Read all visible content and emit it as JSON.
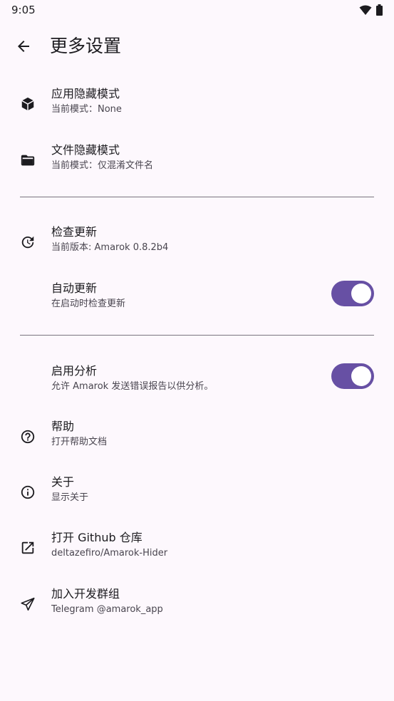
{
  "status": {
    "time": "9:05"
  },
  "header": {
    "title": "更多设置"
  },
  "sections": {
    "hide": {
      "app_hide": {
        "title": "应用隐藏模式",
        "subtitle": "当前模式：None"
      },
      "file_hide": {
        "title": "文件隐藏模式",
        "subtitle": "当前模式：仅混淆文件名"
      }
    },
    "update": {
      "check": {
        "title": "检查更新",
        "subtitle": "当前版本: Amarok 0.8.2b4"
      },
      "auto": {
        "title": "自动更新",
        "subtitle": "在启动时检查更新",
        "enabled": true
      }
    },
    "other": {
      "analytics": {
        "title": "启用分析",
        "subtitle": "允许 Amarok 发送错误报告以供分析。",
        "enabled": true
      },
      "help": {
        "title": "帮助",
        "subtitle": "打开帮助文档"
      },
      "about": {
        "title": "关于",
        "subtitle": "显示关于"
      },
      "github": {
        "title": "打开 Github 仓库",
        "subtitle": "deltazefiro/Amarok-Hider"
      },
      "group": {
        "title": "加入开发群组",
        "subtitle": "Telegram @amarok_app"
      }
    }
  },
  "colors": {
    "accent": "#6750a4",
    "background": "#fdf8fd",
    "divider": "#79747e"
  },
  "icons": {
    "app_hide": "cube-icon",
    "file_hide": "folder-open-icon",
    "check_update": "update-icon",
    "help": "help-circle-icon",
    "about": "info-icon",
    "github": "open-in-new-icon",
    "group": "send-icon"
  }
}
